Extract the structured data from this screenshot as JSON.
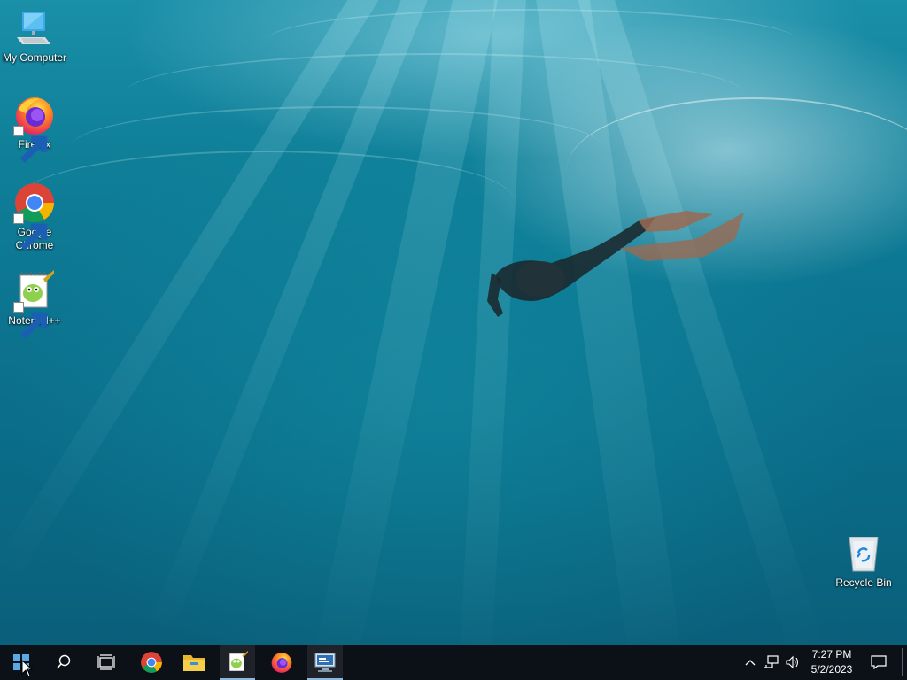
{
  "desktop": {
    "icons": [
      {
        "label": "My Computer",
        "icon": "computer-icon",
        "shortcut": false
      },
      {
        "label": "Firefox",
        "icon": "firefox-icon",
        "shortcut": true
      },
      {
        "label": "Google Chrome",
        "icon": "chrome-icon",
        "shortcut": true
      },
      {
        "label": "Notepad++",
        "icon": "notepadpp-icon",
        "shortcut": true
      },
      {
        "label": "Recycle Bin",
        "icon": "recycle-bin-icon",
        "shortcut": false
      }
    ],
    "wallpaper": "underwater-freediver"
  },
  "taskbar": {
    "start_icon": "windows-logo-icon",
    "search_icon": "search-icon",
    "task_view_icon": "task-view-icon",
    "pinned": [
      {
        "app": "Google Chrome",
        "icon": "chrome-icon",
        "active": false
      },
      {
        "app": "File Explorer",
        "icon": "folder-icon",
        "active": false
      },
      {
        "app": "Notepad++",
        "icon": "notepadpp-icon",
        "active": true
      },
      {
        "app": "Firefox",
        "icon": "firefox-icon",
        "active": false
      },
      {
        "app": "Remote Desktop Connection",
        "icon": "remote-desktop-icon",
        "active": true
      }
    ],
    "tray": {
      "icons": [
        "chevron-up-icon",
        "network-icon",
        "volume-icon"
      ],
      "time": "7:27 PM",
      "date": "5/2/2023",
      "notification_icon": "notification-icon"
    }
  },
  "colors": {
    "taskbar_bg": "#0c1117",
    "active_indicator": "#8ab8de",
    "water": "#0c7490"
  }
}
